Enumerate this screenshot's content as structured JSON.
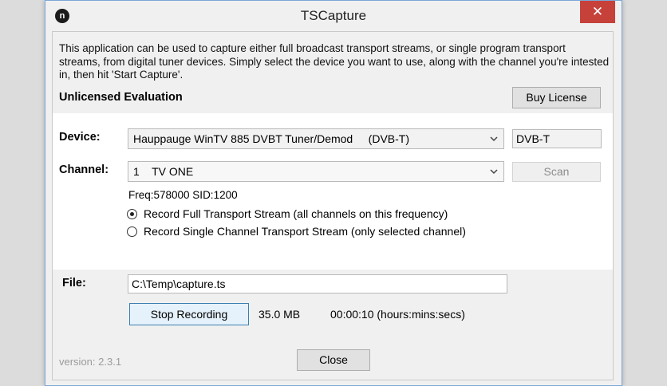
{
  "window": {
    "title": "TSCapture",
    "close_glyph": "✕",
    "icon_letter": "n"
  },
  "description": "This application can be used to capture either full broadcast transport streams, or single program transport streams, from digital tuner devices. Simply select the device you want to use, along with the channel you're intested in, then hit 'Start Capture'.",
  "license": {
    "status": "Unlicensed Evaluation",
    "buy_label": "Buy License"
  },
  "device": {
    "label": "Device:",
    "selected": "Hauppauge WinTV 885 DVBT Tuner/Demod     (DVB-T)",
    "type": "DVB-T"
  },
  "channel": {
    "label": "Channel:",
    "selected": "1    TV ONE",
    "scan_label": "Scan"
  },
  "freq_info": "Freq:578000 SID:1200",
  "record_mode": {
    "options": [
      {
        "label": "Record Full Transport Stream (all channels on this frequency)",
        "selected": true
      },
      {
        "label": "Record Single Channel Transport Stream (only selected channel)",
        "selected": false
      }
    ]
  },
  "file": {
    "label": "File:",
    "path": "C:\\Temp\\capture.ts"
  },
  "recording": {
    "stop_label": "Stop Recording",
    "size": "35.0 MB",
    "elapsed": "00:00:10 (hours:mins:secs)"
  },
  "footer": {
    "version": "version: 2.3.1",
    "close_label": "Close"
  },
  "colors": {
    "close_button": "#c7413b",
    "focus_border": "#3c7fb1",
    "window_border": "#7aa7d8"
  }
}
